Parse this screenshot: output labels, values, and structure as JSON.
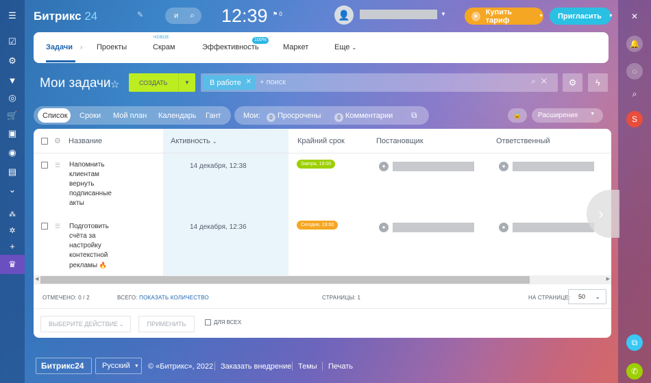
{
  "header": {
    "logo_text": "Битрикс",
    "logo_num": "24",
    "search_label": "и",
    "clock": "12:39",
    "flag_count": "0",
    "buy_label": "Купить тариф",
    "invite_label": "Пригласить"
  },
  "tabs": [
    {
      "label": "Задачи",
      "active": true
    },
    {
      "label": "Проекты"
    },
    {
      "label": "Скрам",
      "badge": "НОВОЕ"
    },
    {
      "label": "Эффективность",
      "badge": "100%"
    },
    {
      "label": "Маркет"
    },
    {
      "label": "Еще"
    }
  ],
  "toolbar": {
    "page_title": "Мои задачи",
    "create_label": "СОЗДАТЬ",
    "filter_chip": "В работе",
    "filter_placeholder": "+ поиск"
  },
  "views": {
    "items": [
      "Список",
      "Сроки",
      "Мой план",
      "Календарь",
      "Гант"
    ],
    "active": "Список"
  },
  "counters": {
    "label": "Мои:",
    "overdue_count": "0",
    "overdue_label": "Просрочены",
    "comments_count": "0",
    "comments_label": "Комментарии"
  },
  "extensions_label": "Расширения",
  "grid": {
    "columns": [
      "Название",
      "Активность",
      "Крайний срок",
      "Постановщик",
      "Ответственный"
    ],
    "rows": [
      {
        "title_lines": [
          "Напомнить",
          "клиентам",
          "вернуть",
          "подписанные",
          "акты"
        ],
        "activity": "14 декабря, 12:38",
        "deadline": "Завтра, 19:00",
        "deadline_color": "#9dcf00"
      },
      {
        "title_lines": [
          "Подготовить",
          "счёта за",
          "настройку",
          "контекстной",
          "рекламы"
        ],
        "activity": "14 декабря, 12:36",
        "deadline": "Сегодня, 19:00",
        "deadline_color": "#f5a623"
      }
    ]
  },
  "footer_bar": {
    "selected": "ОТМЕЧЕНО: 0 / 2",
    "total_label": "ВСЕГО:",
    "show_count": "ПОКАЗАТЬ КОЛИЧЕСТВО",
    "pages": "СТРАНИЦЫ: 1",
    "per_page_label": "НА СТРАНИЦЕ:",
    "per_page_value": "50",
    "action_select": "ВЫБЕРИТЕ ДЕЙСТВИЕ",
    "apply": "ПРИМЕНИТЬ",
    "for_all": "ДЛЯ ВСЕХ"
  },
  "page_footer": {
    "bx24": "Битрикс24",
    "lang": "Русский",
    "copyright": "© «Битрикс», 2022",
    "order": "Заказать внедрение",
    "themes": "Темы",
    "print": "Печать"
  },
  "right_nav": {
    "avatar_letter": "S"
  },
  "colors": {
    "accent_blue": "#2066b0",
    "create_green": "#bbed21",
    "buy_orange": "#f5a623",
    "invite_cyan": "#29c0e4",
    "chip_blue": "#58bde8"
  }
}
